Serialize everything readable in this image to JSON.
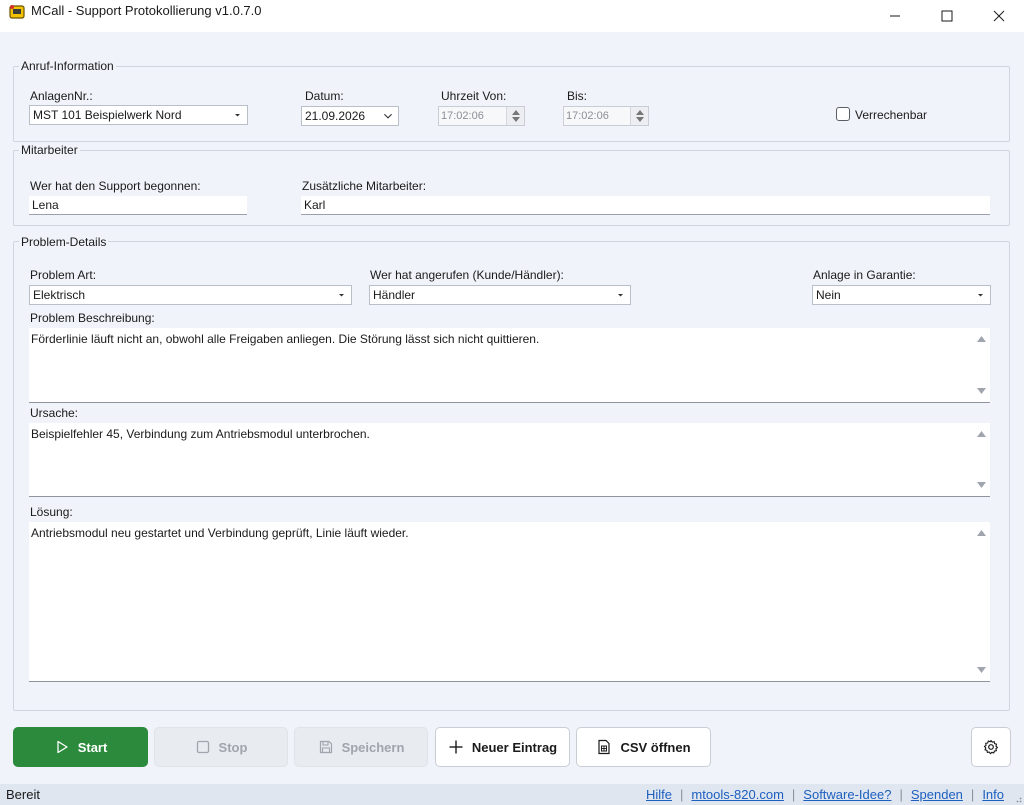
{
  "window": {
    "title": "MCall - Support Protokollierung  v1.0.7.0"
  },
  "call_info": {
    "group_label": "Anruf-Information",
    "plant_label": "AnlagenNr.:",
    "plant_value": "MST 101 Beispielwerk Nord",
    "date_label": "Datum:",
    "date_value": "21.09.2026",
    "time_from_label": "Uhrzeit Von:",
    "time_from_value": "17:02:06",
    "time_to_label": "Bis:",
    "time_to_value": "17:02:06",
    "billable_label": "Verrechenbar",
    "billable_checked": false
  },
  "staff": {
    "group_label": "Mitarbeiter",
    "started_by_label": "Wer hat den Support begonnen:",
    "started_by_value": "Lena",
    "additional_label": "Zusätzliche Mitarbeiter:",
    "additional_value": "Karl"
  },
  "problem": {
    "group_label": "Problem-Details",
    "type_label": "Problem Art:",
    "type_value": "Elektrisch",
    "caller_label": "Wer hat angerufen (Kunde/Händler):",
    "caller_value": "Händler",
    "warranty_label": "Anlage in Garantie:",
    "warranty_value": "Nein",
    "description_label": "Problem Beschreibung:",
    "description_value": "Förderlinie läuft nicht an, obwohl alle Freigaben anliegen. Die Störung lässt sich nicht quittieren.",
    "cause_label": "Ursache:",
    "cause_value": "Beispielfehler 45, Verbindung zum Antriebsmodul unterbrochen.",
    "solution_label": "Lösung:",
    "solution_value": "Antriebsmodul neu gestartet und Verbindung geprüft, Linie läuft wieder."
  },
  "toolbar": {
    "start_label": "Start",
    "stop_label": "Stop",
    "save_label": "Speichern",
    "new_entry_label": "Neuer Eintrag",
    "csv_label": "CSV öffnen",
    "stop_disabled": true,
    "save_disabled": true
  },
  "statusbar": {
    "status": "Bereit",
    "links": [
      "Hilfe",
      "mtools-820.com",
      "Software-Idee?",
      "Spenden",
      "Info"
    ]
  },
  "colors": {
    "accent_green": "#2c8a3c",
    "link_blue": "#1d5fbf",
    "background": "#f0f3f9"
  }
}
